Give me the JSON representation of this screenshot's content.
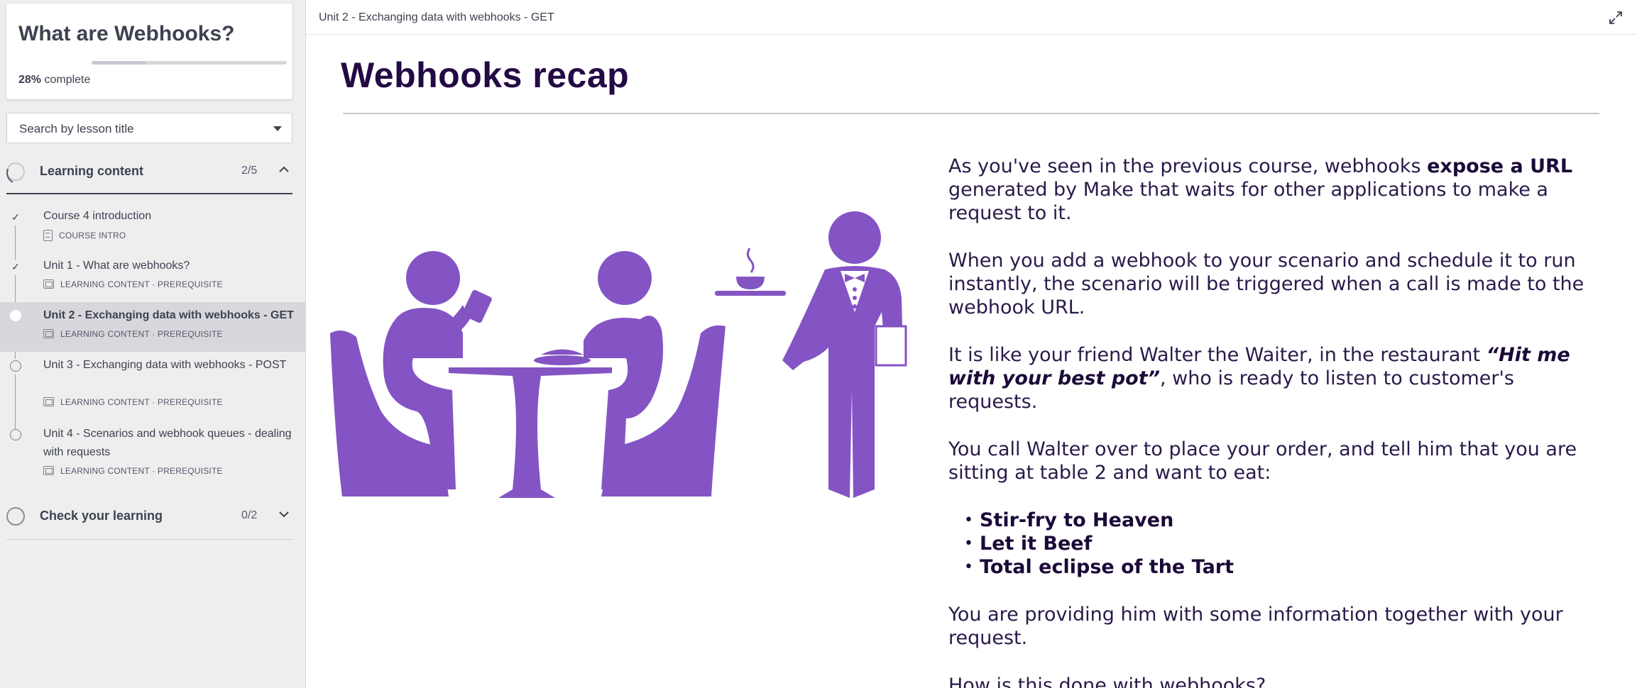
{
  "sidebar": {
    "course_title": "What are Webhooks?",
    "progress_percent": 28,
    "progress_value": "28%",
    "progress_suffix": " complete",
    "search_placeholder": "Search by lesson title",
    "sections": [
      {
        "label": "Learning content",
        "count": "2/5",
        "expanded": true,
        "lessons": [
          {
            "title": "Course 4 introduction",
            "meta": "COURSE INTRO",
            "status": "done"
          },
          {
            "title": "Unit 1 - What are webhooks?",
            "meta": "LEARNING CONTENT · PREREQUISITE",
            "status": "done"
          },
          {
            "title": "Unit 2 - Exchanging data with webhooks - GET",
            "meta": "LEARNING CONTENT · PREREQUISITE",
            "status": "current"
          },
          {
            "title": "Unit 3 - Exchanging data with webhooks - POST",
            "meta": "LEARNING CONTENT · PREREQUISITE",
            "status": "open"
          },
          {
            "title": "Unit 4 - Scenarios and webhook queues - dealing with requests",
            "meta": "LEARNING CONTENT · PREREQUISITE",
            "status": "open"
          }
        ]
      },
      {
        "label": "Check your learning",
        "count": "0/2",
        "expanded": false
      }
    ]
  },
  "header": {
    "breadcrumb": "Unit 2 - Exchanging data with webhooks - GET"
  },
  "main": {
    "title": "Webhooks recap",
    "p1_a": "As you've seen in the previous course, webhooks ",
    "p1_b": "expose a URL",
    "p1_c": " generated by Make that waits for other applications to make a request to it.",
    "p2": "When you add a webhook to your scenario and schedule it to run instantly, the scenario will be triggered when a call is made to the webhook URL.",
    "p3_a": "It is like your friend Walter the Waiter, in the restaurant ",
    "p3_b": "“Hit me with your best pot”",
    "p3_c": ", who is ready to listen to customer's requests.",
    "p4": "You call Walter over to place your order, and tell him that you are sitting at table 2 and want to eat:",
    "dishes": [
      "Stir-fry to Heaven",
      "Let it Beef",
      "Total eclipse of the Tart"
    ],
    "p5": "You are providing him with some information together with your request.",
    "p6": "How is this done with webhooks?"
  },
  "colors": {
    "illustration": "#8454c4",
    "title": "#230a44",
    "sidebar_bg": "#eeeeef",
    "active_lesson_bg": "#d7d7dc"
  }
}
